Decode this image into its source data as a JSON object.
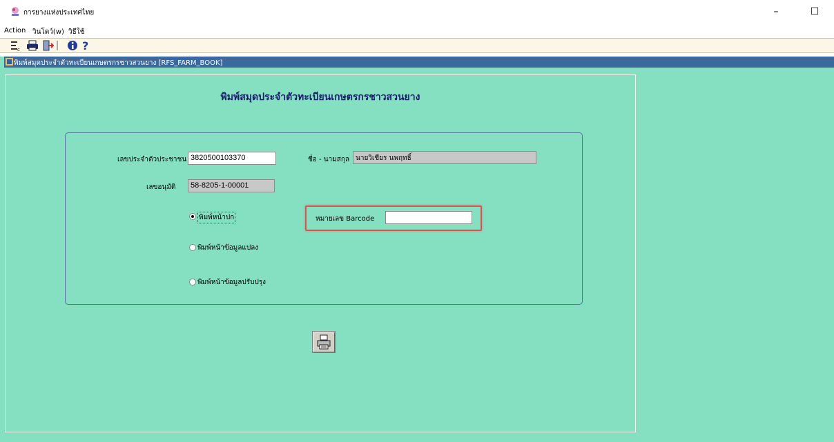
{
  "window": {
    "title": "การยางแห่งประเทศไทย",
    "minimize": "–",
    "maximize": "☐"
  },
  "menu": {
    "items": [
      "Action",
      "วินโดว์(w)",
      "วิธีใช้"
    ]
  },
  "child_window": {
    "title": "พิมพ์สมุดประจำตัวทะเบียนเกษตรกรชาวสวนยาง [RFS_FARM_BOOK]"
  },
  "form": {
    "heading": "พิมพ์สมุดประจำตัวทะเบียนเกษตรกรชาวสวนยาง",
    "citizen_id_label": "เลขประจำตัวประชาชน",
    "citizen_id_value": "3820500103370",
    "name_label": "ชื่อ - นามสกุล",
    "name_value": "นายวิเชียร นพฤทธิ์",
    "permit_label": "เลขอนุมัติ",
    "permit_value": "58-8205-1-00001",
    "radio_cover": "พิมพ์หน้าปก",
    "radio_plot": "พิมพ์หน้าข้อมูลแปลง",
    "radio_update": "พิมพ์หน้าข้อมูลปรับปรุง",
    "barcode_label": "หมายเลข Barcode",
    "barcode_value": ""
  },
  "colors": {
    "background": "#84e0c0",
    "child_title_bar": "#39699d",
    "toolbar": "#fbf6e6",
    "highlight": "#e05050"
  }
}
